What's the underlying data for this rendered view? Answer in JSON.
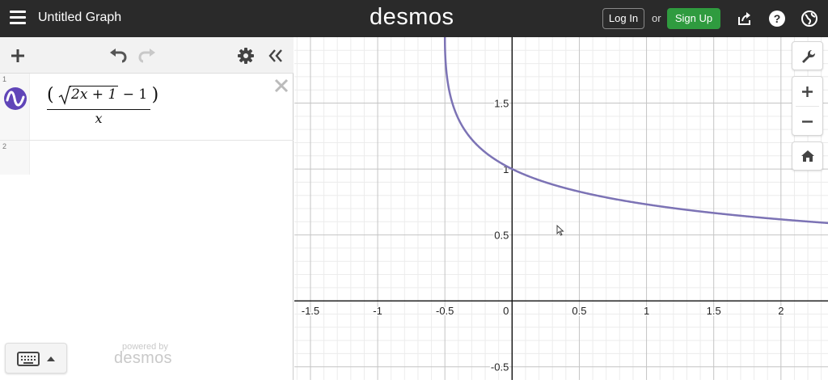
{
  "header": {
    "title": "Untitled Graph",
    "brand": "desmos",
    "login_label": "Log In",
    "or_text": "or",
    "signup_label": "Sign Up",
    "icons": [
      "menu-icon",
      "share-icon",
      "help-icon",
      "language-icon"
    ]
  },
  "colors": {
    "topbar": "#2a2a2a",
    "signup": "#2f9b3f",
    "curve": "#7c73b5",
    "expression_icon": "#6045b8"
  },
  "toolbar": {
    "icons": [
      "add-icon",
      "undo-icon",
      "redo-icon",
      "settings-icon",
      "collapse-icon"
    ]
  },
  "expressions": [
    {
      "number": "1",
      "numerator_open": "(",
      "radicand": "2x + 1",
      "numerator_tail": "− 1",
      "numerator_close": ")",
      "denominator": "x",
      "color": "#6045b8"
    },
    {
      "number": "2"
    }
  ],
  "footer": {
    "powered_small": "powered by",
    "powered_brand": "desmos"
  },
  "graph_controls": [
    "wrench-icon",
    "zoom-in-icon",
    "zoom-out-icon",
    "home-icon"
  ],
  "chart_data": {
    "type": "line",
    "function": "(sqrt(2x+1) - 1) / x",
    "xlim": [
      -1.62,
      2.35
    ],
    "ylim": [
      -0.6,
      2.0
    ],
    "x_ticks": [
      "-1.5",
      "-1",
      "-0.5",
      "0",
      "0.5",
      "1",
      "1.5",
      "2"
    ],
    "y_ticks": [
      "1.5",
      "1",
      "0.5",
      "-0.5"
    ],
    "grid": true,
    "series": [
      {
        "color": "#7c73b5",
        "x": [
          -0.5,
          -0.45,
          -0.4,
          -0.3,
          -0.2,
          -0.1,
          0,
          0.25,
          0.5,
          1,
          1.5,
          2,
          2.35
        ],
        "y": [
          2.0,
          1.37,
          1.38,
          1.23,
          1.13,
          1.06,
          1.0,
          0.9,
          0.83,
          0.73,
          0.67,
          0.62,
          0.59
        ]
      }
    ]
  }
}
